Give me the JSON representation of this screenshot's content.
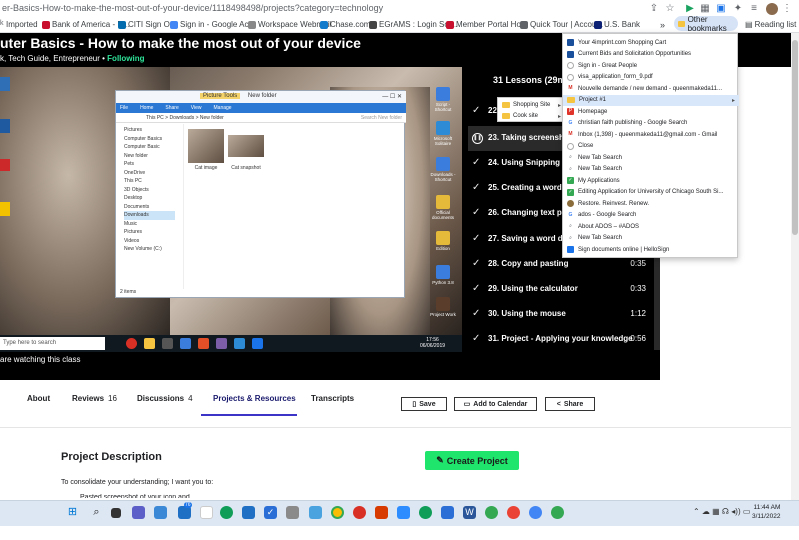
{
  "browser": {
    "url": "er-Basics-How-to-make-the-most-out-of-your-device/1118498498/projects?category=technology",
    "other_bookmarks_label": "Other bookmarks",
    "reading_list_label": "Reading list",
    "bookmarks_bar": [
      {
        "label": "Imported",
        "color": "#f5c542"
      },
      {
        "label": "Bank of America - B...",
        "color": "#c8102e"
      },
      {
        "label": "CITI Sign On",
        "color": "#056dae"
      },
      {
        "label": "Sign in - Google Ac...",
        "color": "#4285f4"
      },
      {
        "label": "Workspace Webmail",
        "color": "#888888"
      },
      {
        "label": "Chase.com",
        "color": "#117aca"
      },
      {
        "label": "EGrAMS : Login Scr...",
        "color": "#444444"
      },
      {
        "label": "Member Portal Ho...",
        "color": "#c8102e"
      },
      {
        "label": "Quick Tour | Accou...",
        "color": "#5f6368"
      },
      {
        "label": "U.S. Bank",
        "color": "#0c2074"
      }
    ],
    "more_chevron": "»"
  },
  "course": {
    "title": "uter Basics - How to make the most out of your device",
    "subtitle": "k, Tech Guide, Entrepreneur •",
    "following_label": "Following",
    "watching_text": "are watching this class"
  },
  "video": {
    "explorer": {
      "title": "New folder",
      "picture_tools": "Picture Tools",
      "ribbon_tabs": [
        "File",
        "Home",
        "Share",
        "View",
        "Manage"
      ],
      "path": "This PC > Downloads > New folder",
      "search_placeholder": "Search New folder",
      "nav_items": [
        "Pictures",
        "Computer Basics",
        "Computer Basic",
        "New folder",
        "Pets",
        "",
        "OneDrive",
        "",
        "This PC",
        "3D Objects",
        "Desktop",
        "Documents",
        "Downloads",
        "Music",
        "Pictures",
        "Videos",
        "New Volume (C:)"
      ],
      "files": [
        {
          "name": "Cat image"
        },
        {
          "name": "Cat snapshot"
        }
      ],
      "status": "2 items"
    },
    "desktop_icons": [
      "Script - Shortcut",
      "Microsoft Solitaire",
      "Downloads - Shortcut",
      "Official documents",
      "Edition",
      "Pro",
      "Python 3.8",
      "Project Work"
    ],
    "search_placeholder": "Type here to search",
    "clock": {
      "time": "17:56",
      "date": "06/06/2019"
    }
  },
  "lessons": {
    "header": "31 Lessons (29m)",
    "items": [
      {
        "label": "22.",
        "duration": "",
        "active": false
      },
      {
        "label": "23. Taking screensho",
        "duration": "",
        "active": true
      },
      {
        "label": "24. Using Snipping To",
        "duration": "",
        "active": false
      },
      {
        "label": "25. Creating a word d",
        "duration": "",
        "active": false
      },
      {
        "label": "26. Changing text pro",
        "duration": "",
        "active": false
      },
      {
        "label": "27. Saving a word doc",
        "duration": "",
        "active": false
      },
      {
        "label": "28. Copy and pasting",
        "duration": "0:35",
        "active": false
      },
      {
        "label": "29. Using the calculator",
        "duration": "0:33",
        "active": false
      },
      {
        "label": "30. Using the mouse",
        "duration": "1:12",
        "active": false
      },
      {
        "label": "31. Project - Applying your knowledge",
        "duration": "0:56",
        "active": false
      }
    ]
  },
  "tabs": [
    {
      "label": "About",
      "count": ""
    },
    {
      "label": "Reviews",
      "count": "16"
    },
    {
      "label": "Discussions",
      "count": "4"
    },
    {
      "label": "Projects & Resources",
      "count": ""
    },
    {
      "label": "Transcripts",
      "count": ""
    }
  ],
  "actions": {
    "save": "Save",
    "add_to_calendar": "Add to Calendar",
    "share": "Share"
  },
  "project": {
    "heading": "Project Description",
    "create_button": "Create Project",
    "intro": "To consolidate your understanding; I want you to:",
    "bullet": "Pasted  screenshot  of  your  icon  and"
  },
  "bookmark_menu": {
    "items": [
      {
        "label": "Your 4imprint.com Shopping Cart",
        "color": "#1a4f9c",
        "glyph": ""
      },
      {
        "label": "Current Bids and Solicitation Opportunities",
        "color": "#1a4f9c",
        "glyph": ""
      },
      {
        "label": "Sign in - Great People",
        "color": "#8a8a8a",
        "glyph": "○"
      },
      {
        "label": "visa_application_form_9.pdf",
        "color": "#8a8a8a",
        "glyph": "○"
      },
      {
        "label": "Nouvelle demande / new demand - queenmakeda11...",
        "color": "#d93025",
        "glyph": "M"
      },
      {
        "label": "Project #1",
        "color": "#f5c542",
        "glyph": "",
        "submenu": true
      },
      {
        "label": "Homepage",
        "color": "#e0342a",
        "glyph": "P"
      },
      {
        "label": "christian faith publishing - Google Search",
        "color": "#4285f4",
        "glyph": "G"
      },
      {
        "label": "Inbox (1,398) - queenmakeda11@gmail.com - Gmail",
        "color": "#d93025",
        "glyph": "M"
      },
      {
        "label": "Close",
        "color": "#8a8a8a",
        "glyph": "○"
      },
      {
        "label": "New Tab Search",
        "color": "#8a8a8a",
        "glyph": "○"
      },
      {
        "label": "New Tab Search",
        "color": "#8a8a8a",
        "glyph": "○"
      },
      {
        "label": "My Applications",
        "color": "#34a853",
        "glyph": "✓"
      },
      {
        "label": "Editing Application for University of Chicago South Si...",
        "color": "#34a853",
        "glyph": "✓"
      },
      {
        "label": "Restore. Reinvest. Renew.",
        "color": "#8a6d3b",
        "glyph": ""
      },
      {
        "label": "ados - Google Search",
        "color": "#4285f4",
        "glyph": "G"
      },
      {
        "label": "About ADOS – #ADOS",
        "color": "#8a8a8a",
        "glyph": "○"
      },
      {
        "label": "New Tab Search",
        "color": "#8a8a8a",
        "glyph": "○"
      },
      {
        "label": "Sign documents online | HelloSign",
        "color": "#1a73e8",
        "glyph": ""
      }
    ],
    "submenu": [
      {
        "label": "Shopping Site"
      },
      {
        "label": "Cook site"
      }
    ]
  },
  "system": {
    "time": "11:44 AM",
    "date": "3/11/2022",
    "taskbar_badge": "76"
  }
}
